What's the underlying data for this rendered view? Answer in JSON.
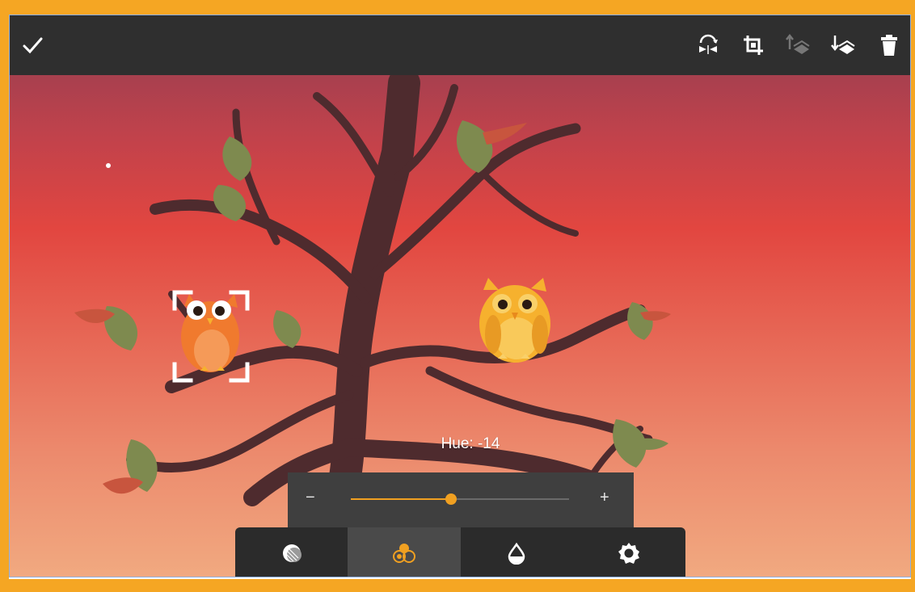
{
  "toolbar": {
    "confirm_icon": "checkmark-icon",
    "actions": [
      "flip-icon",
      "crop-icon",
      "bring-forward-icon",
      "send-backward-icon",
      "delete-icon"
    ]
  },
  "adjustment": {
    "label": "Hue: -14",
    "minus": "−",
    "plus": "+",
    "value_fraction": 0.46,
    "accent_color": "#f0a021"
  },
  "tabs": [
    {
      "icon": "blend-icon",
      "active": false
    },
    {
      "icon": "color-adjust-icon",
      "active": true
    },
    {
      "icon": "opacity-icon",
      "active": false
    },
    {
      "icon": "settings-icon",
      "active": false
    }
  ],
  "colors": {
    "sky_top": "#8f3e52",
    "sky_bottom": "#f1a980",
    "tree": "#4e2b2e",
    "leaf": "#7e8a4f",
    "selected_owl": "#f07a2e",
    "other_owl": "#f6b12e",
    "toolbar_bg": "#2f2f2f"
  }
}
